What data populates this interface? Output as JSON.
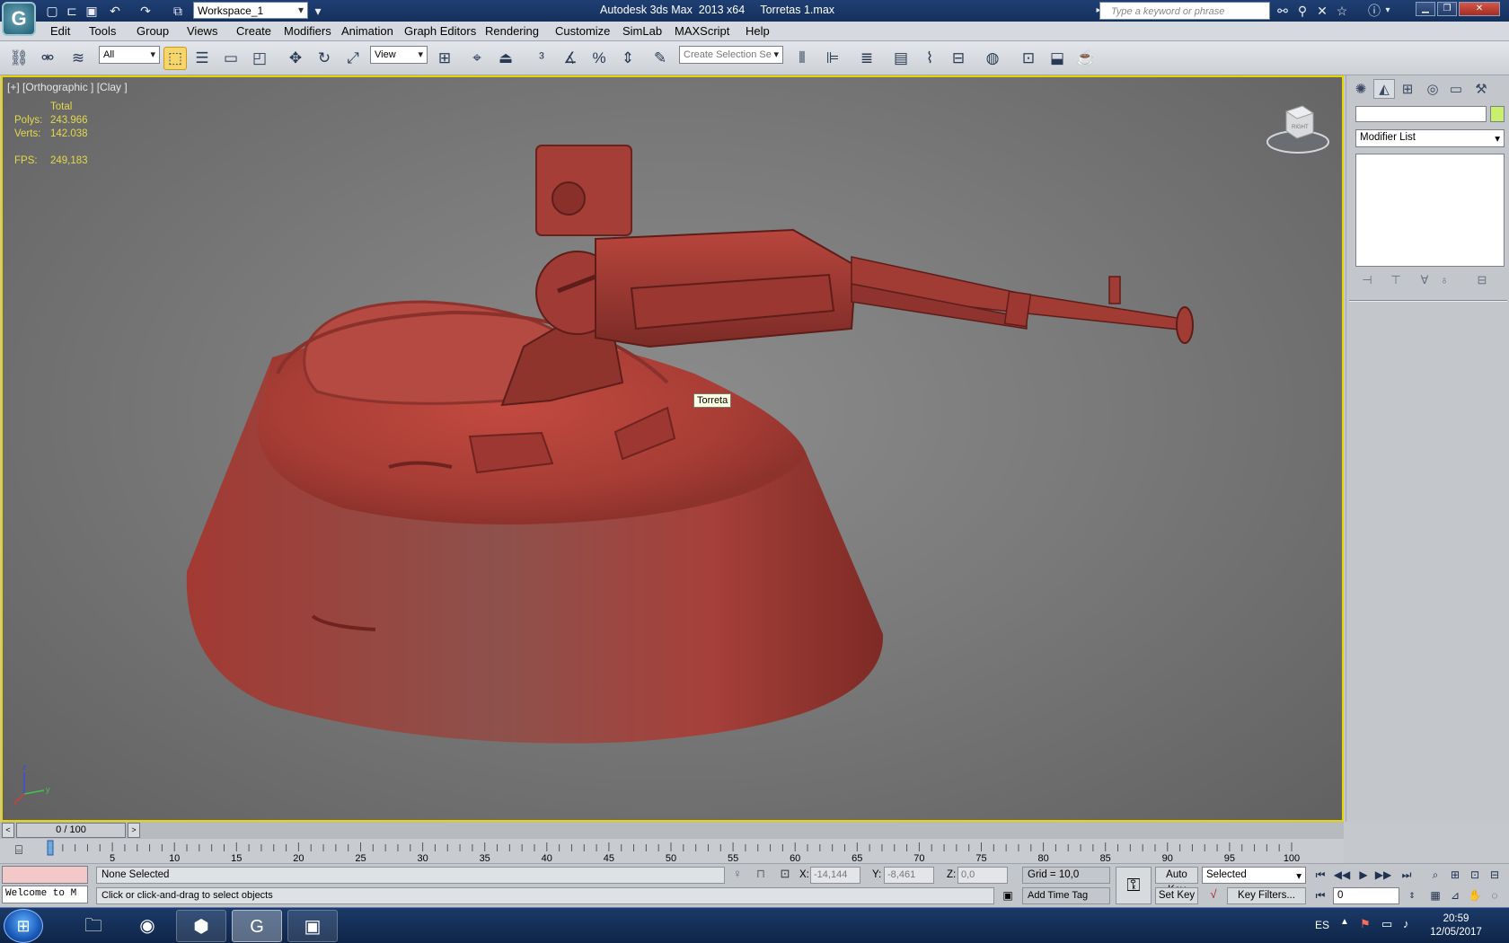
{
  "title_bar": {
    "workspace": "Workspace_1",
    "app_title": "Autodesk 3ds Max  2013 x64     Torretas 1.max",
    "search_placeholder": "Type a keyword or phrase"
  },
  "menu": [
    "Edit",
    "Tools",
    "Group",
    "Views",
    "Create",
    "Modifiers",
    "Animation",
    "Graph Editors",
    "Rendering",
    "Customize",
    "SimLab",
    "MAXScript",
    "Help"
  ],
  "toolbar": {
    "selection_filter": "All",
    "reference_coord": "View",
    "named_selection_placeholder": "Create Selection Se"
  },
  "viewport": {
    "label": "[+] [Orthographic ] [Clay ]",
    "stats": {
      "header": "Total",
      "polys_label": "Polys:",
      "polys_value": "243.966",
      "verts_label": "Verts:",
      "verts_value": "142.038",
      "fps_label": "FPS:",
      "fps_value": "249,183"
    },
    "tooltip": "Torreta",
    "viewcube_face": "RIGHT",
    "axis": {
      "x": "x",
      "y": "y",
      "z": "z"
    },
    "model_color": "#b5433b"
  },
  "command_panel": {
    "modifier_list": "Modifier List",
    "object_color": "#c8f06e"
  },
  "timeline": {
    "slider": "0 / 100",
    "ticks": [
      "0",
      "5",
      "10",
      "15",
      "20",
      "25",
      "30",
      "35",
      "40",
      "45",
      "50",
      "55",
      "60",
      "65",
      "70",
      "75",
      "80",
      "85",
      "90",
      "95",
      "100"
    ]
  },
  "status": {
    "selection": "None Selected",
    "prompt": "Click or click-and-drag to select objects",
    "welcome": "Welcome to M",
    "x_label": "X:",
    "x_value": "-14,144",
    "y_label": "Y:",
    "y_value": "-8,461",
    "z_label": "Z:",
    "z_value": "0,0",
    "grid": "Grid = 10,0",
    "add_time_tag": "Add Time Tag",
    "auto_key": "Auto Key",
    "set_key": "Set Key",
    "key_mode": "Selected",
    "key_filters": "Key Filters...",
    "frame": "0"
  },
  "taskbar": {
    "language": "ES",
    "time": "20:59",
    "date": "12/05/2017"
  }
}
